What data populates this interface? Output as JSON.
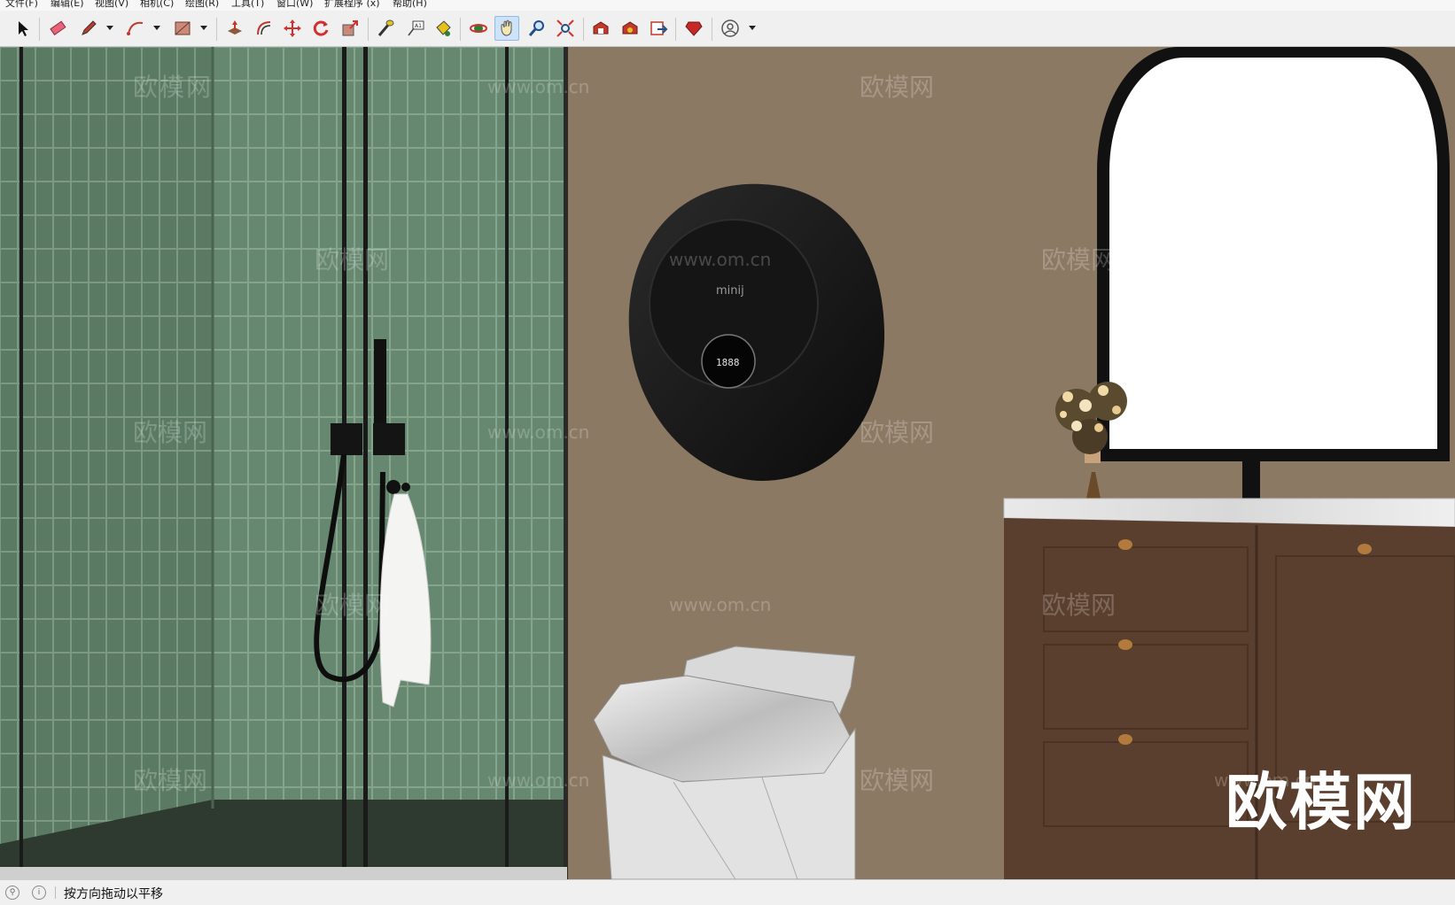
{
  "menu": [
    "文件(F)",
    "编辑(E)",
    "视图(V)",
    "相机(C)",
    "绘图(R)",
    "工具(T)",
    "窗口(W)",
    "扩展程序 (x)",
    "帮助(H)"
  ],
  "toolbar": {
    "tools": [
      {
        "name": "select-icon"
      },
      {
        "name": "eraser-icon"
      },
      {
        "name": "pencil-icon"
      },
      {
        "name": "arc-icon"
      },
      {
        "name": "shape-icon"
      },
      {
        "name": "push-pull-icon"
      },
      {
        "name": "offset-icon"
      },
      {
        "name": "move-icon"
      },
      {
        "name": "rotate-icon"
      },
      {
        "name": "scale-icon"
      },
      {
        "name": "tape-measure-icon"
      },
      {
        "name": "text-icon"
      },
      {
        "name": "paint-bucket-icon"
      },
      {
        "name": "orbit-icon"
      },
      {
        "name": "pan-icon",
        "active": true
      },
      {
        "name": "zoom-icon"
      },
      {
        "name": "zoom-extents-icon"
      },
      {
        "name": "warehouse-icon"
      },
      {
        "name": "extension-warehouse-icon"
      },
      {
        "name": "layout-send-icon"
      },
      {
        "name": "ruby-icon"
      },
      {
        "name": "account-icon"
      }
    ]
  },
  "scene": {
    "watermark_cn": "欧模网",
    "watermark_url": "www.om.cn",
    "logo_text": "欧模网",
    "heater_brand": "minij",
    "heater_display": "1888"
  },
  "status": {
    "text": "按方向拖动以平移"
  }
}
